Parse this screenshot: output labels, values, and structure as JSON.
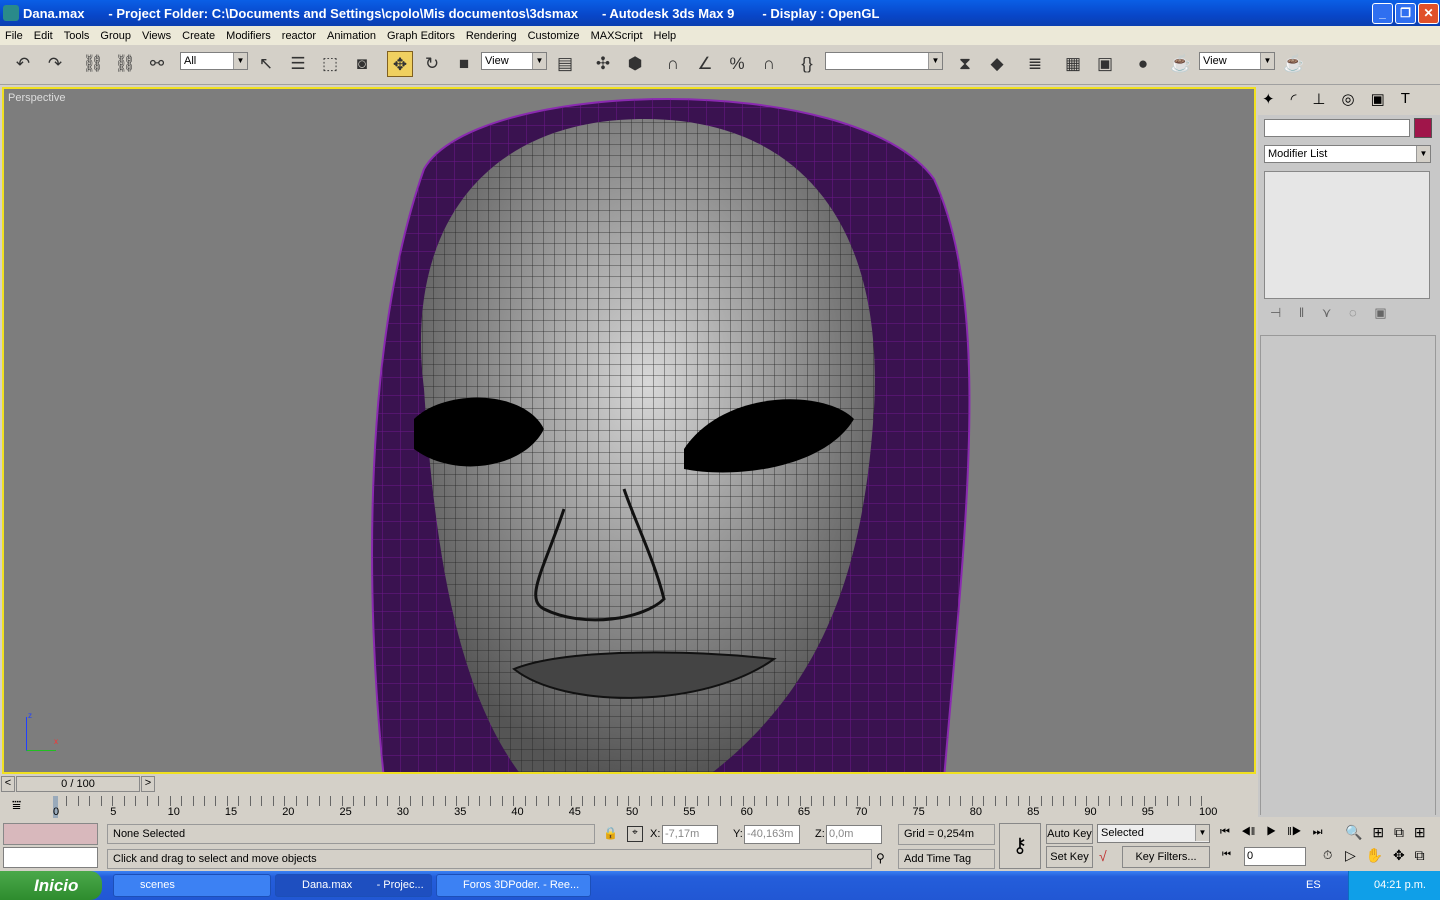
{
  "title": {
    "file": "Dana.max",
    "project": "- Project Folder: C:\\Documents and Settings\\cpolo\\Mis documentos\\3dsmax",
    "app": "- Autodesk 3ds Max 9",
    "display": "- Display : OpenGL"
  },
  "menu": [
    "File",
    "Edit",
    "Tools",
    "Group",
    "Views",
    "Create",
    "Modifiers",
    "reactor",
    "Animation",
    "Graph Editors",
    "Rendering",
    "Customize",
    "MAXScript",
    "Help"
  ],
  "toolbar": {
    "selection_filter": "All",
    "ref_coord": "View",
    "named_sel": "",
    "render_view": "View"
  },
  "viewport": {
    "label": "Perspective",
    "axis_z": "z",
    "axis_x": "x",
    "wire_color": "#7a1a9a",
    "border_color": "#f0e020"
  },
  "command_panel": {
    "name_field": "",
    "object_color": "#a0154a",
    "modifier_list": "Modifier List"
  },
  "trackbar": {
    "frame": "0 / 100",
    "prev": "<",
    "next": ">"
  },
  "timeline": {
    "ticks": [
      "0",
      "5",
      "10",
      "15",
      "20",
      "25",
      "30",
      "35",
      "40",
      "45",
      "50",
      "55",
      "60",
      "65",
      "70",
      "75",
      "80",
      "85",
      "90",
      "95",
      "100"
    ]
  },
  "status": {
    "selection": "None Selected",
    "prompt": "Click and drag to select and move objects",
    "x_label": "X:",
    "x": "-7,17m",
    "y_label": "Y:",
    "y": "-40,163m",
    "z_label": "Z:",
    "z": "0,0m",
    "grid": "Grid = 0,254m",
    "add_time_tag": "Add Time Tag"
  },
  "animation": {
    "auto_key": "Auto Key",
    "set_key": "Set Key",
    "key_mode": "Selected",
    "key_filters": "Key Filters...",
    "current_frame": "0"
  },
  "taskbar": {
    "start": "Inicio",
    "tasks": [
      "scenes",
      "Dana.max        - Projec...",
      "Foros 3DPoder. - Ree..."
    ],
    "lang": "ES",
    "clock": "04:21 p.m."
  }
}
